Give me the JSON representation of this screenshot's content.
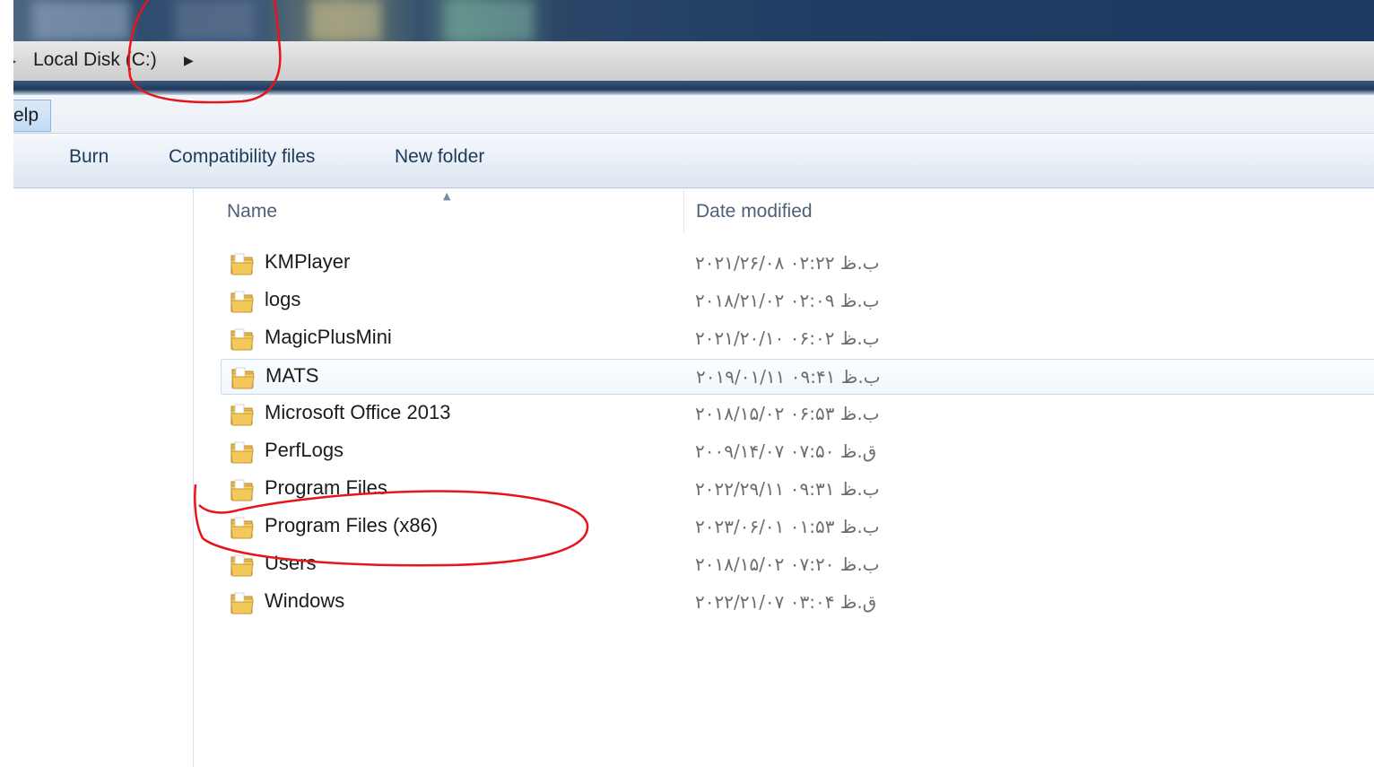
{
  "address_bar": {
    "breadcrumb": "Local Disk (C:)",
    "breadcrumb_arrow_icon": "triangle-right-icon"
  },
  "menu_bar": {
    "help_label": "elp"
  },
  "toolbar": {
    "burn_label": "Burn",
    "compatibility_label": "Compatibility files",
    "new_folder_label": "New folder"
  },
  "columns": {
    "name": "Name",
    "date_modified": "Date modified",
    "sort_icon": "sort-ascending-icon"
  },
  "files": [
    {
      "name": "KMPlayer",
      "date": "۲۰۲۱/۲۶/۰۸ ب.ظ ۰۲:۲۲",
      "icon": "folder-icon"
    },
    {
      "name": "logs",
      "date": "۲۰۱۸/۲۱/۰۲ ب.ظ ۰۲:۰۹",
      "icon": "folder-icon"
    },
    {
      "name": "MagicPlusMini",
      "date": "۲۰۲۱/۲۰/۱۰ ب.ظ ۰۶:۰۲",
      "icon": "folder-icon"
    },
    {
      "name": "MATS",
      "date": "۲۰۱۹/۰۱/۱۱ ب.ظ ۰۹:۴۱",
      "icon": "folder-icon",
      "hovered": true
    },
    {
      "name": "Microsoft Office 2013",
      "date": "۲۰۱۸/۱۵/۰۲ ب.ظ ۰۶:۵۳",
      "icon": "folder-icon"
    },
    {
      "name": "PerfLogs",
      "date": "۲۰۰۹/۱۴/۰۷ ق.ظ ۰۷:۵۰",
      "icon": "folder-icon"
    },
    {
      "name": "Program Files",
      "date": "۲۰۲۲/۲۹/۱۱ ب.ظ ۰۹:۳۱",
      "icon": "folder-icon"
    },
    {
      "name": "Program Files (x86)",
      "date": "۲۰۲۳/۰۶/۰۱ ب.ظ ۰۱:۵۳",
      "icon": "folder-icon"
    },
    {
      "name": "Users",
      "date": "۲۰۱۸/۱۵/۰۲ ب.ظ ۰۷:۲۰",
      "icon": "folder-icon"
    },
    {
      "name": "Windows",
      "date": "۲۰۲۲/۲۱/۰۷ ق.ظ ۰۳:۰۴",
      "icon": "folder-icon"
    }
  ],
  "colors": {
    "annotation_red": "#e8141b",
    "toolbar_text": "#1e395b",
    "header_text": "#4c607a",
    "date_text": "#6d6d6d"
  }
}
